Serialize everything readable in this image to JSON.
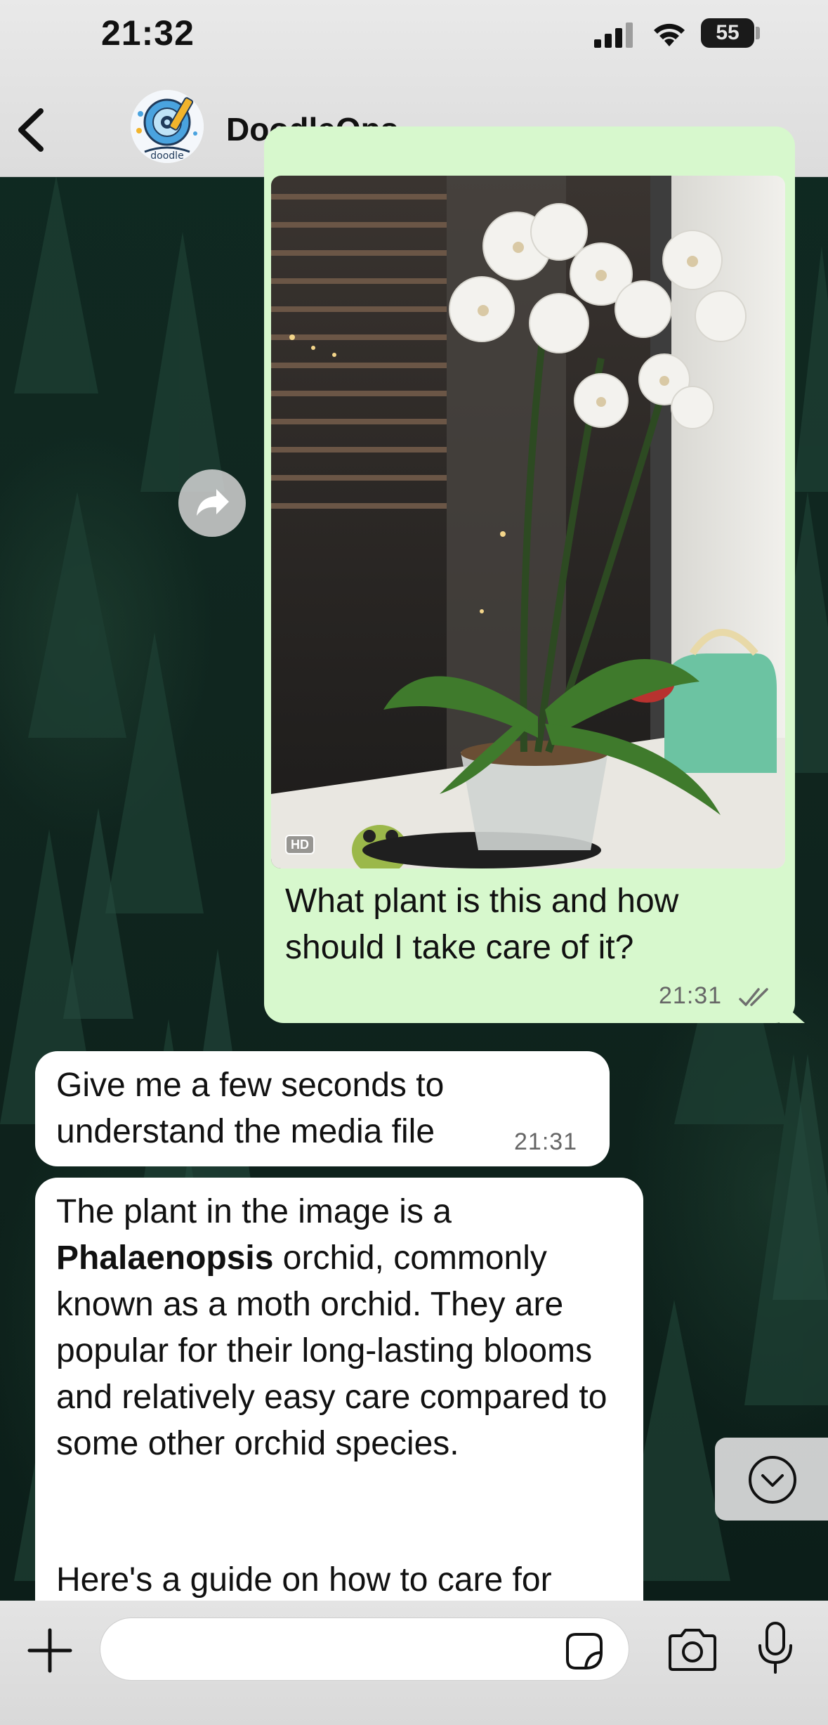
{
  "status_bar": {
    "time": "21:32",
    "battery": "55"
  },
  "header": {
    "title": "DoodleOps",
    "avatar_icon": "doodleops-logo",
    "back_icon": "chevron-left-icon"
  },
  "messages": [
    {
      "direction": "outgoing",
      "type": "image",
      "hd_badge": "HD",
      "caption": "What plant is this and how should I take care of it?",
      "time": "21:31",
      "status_icon": "double-check-icon"
    },
    {
      "direction": "incoming",
      "text": "Give me a few seconds to understand the media file",
      "time": "21:31"
    },
    {
      "direction": "incoming",
      "text_pre": "The plant in the image is a ",
      "text_bold": "Phalaenopsis",
      "text_post": " orchid, commonly known as a moth orchid. They are popular for their long-lasting blooms and relatively easy care compared to some other orchid species.",
      "text_more": "Here's a guide on how to care for"
    }
  ],
  "composer": {
    "input_value": "",
    "plus_icon": "plus-icon",
    "sticker_icon": "sticker-icon",
    "camera_icon": "camera-icon",
    "mic_icon": "microphone-icon"
  },
  "colors": {
    "outgoing_bubble": "#d7f8cd",
    "incoming_bubble": "#ffffff",
    "header_bg": "#e2e2e2"
  }
}
